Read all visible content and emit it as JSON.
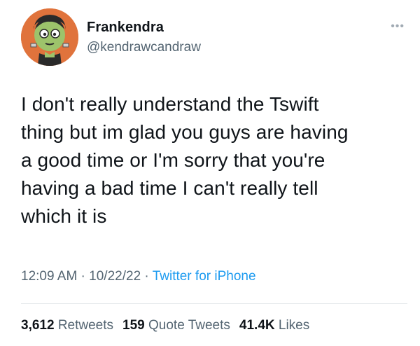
{
  "author": {
    "display_name": "Frankendra",
    "handle": "@kendrawcandraw"
  },
  "more_label": "•••",
  "tweet": {
    "text": "I don't really understand the Tswift\nthing but im glad you guys are having\na good time or I'm sorry that you're\nhaving a bad time I can't really tell\nwhich it is"
  },
  "meta": {
    "time": "12:09 AM",
    "sep1": " · ",
    "date": "10/22/22",
    "sep2": " · ",
    "source": "Twitter for iPhone"
  },
  "stats": {
    "retweets_count": "3,612",
    "retweets_label": "Retweets",
    "quotes_count": "159",
    "quotes_label": "Quote Tweets",
    "likes_count": "41.4K",
    "likes_label": "Likes"
  },
  "colors": {
    "text": "#0f1419",
    "secondary": "#536471",
    "link": "#1d9bf0",
    "avatar_bg": "#e0733c"
  },
  "icons": {
    "avatar": "frankenstein-avatar",
    "more": "more-options-icon"
  }
}
